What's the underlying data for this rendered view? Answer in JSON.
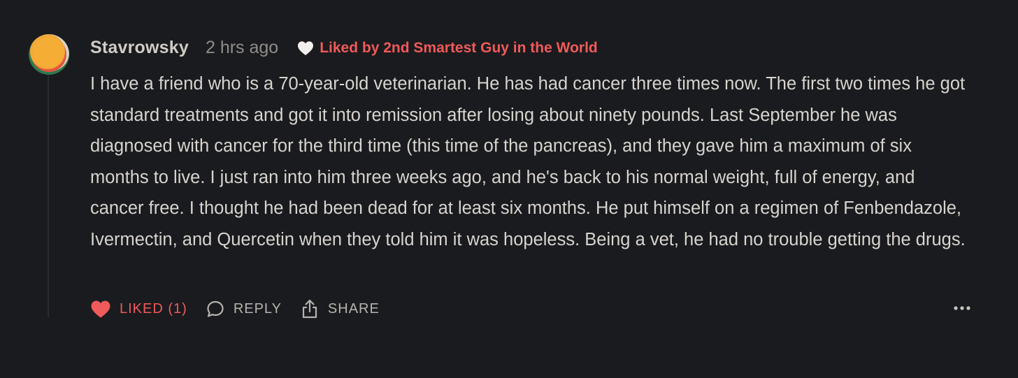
{
  "comment": {
    "author": "Stavrowsky",
    "timestamp": "2 hrs ago",
    "liked_by": "Liked by 2nd Smartest Guy in the World",
    "body": "I have a friend who is a 70-year-old veterinarian. He has had cancer three times now. The first two times he got standard treatments and got it into remission after losing about ninety pounds. Last September he was diagnosed with cancer for the third time (this time of the pancreas), and they gave him a maximum of six months to live. I just ran into him three weeks ago, and he's back to his normal weight, full of energy, and cancer free. I thought he had been dead for at least six months. He put himself on a regimen of Fenbendazole, Ivermectin, and Quercetin when they told him it was hopeless. Being a vet, he had no trouble getting the drugs."
  },
  "actions": {
    "like_label": "LIKED (1)",
    "reply_label": "REPLY",
    "share_label": "SHARE"
  },
  "icons": {
    "like": "heart-filled-icon",
    "reply": "speech-bubble-icon",
    "share": "share-upload-icon",
    "more": "ellipsis-icon",
    "liked_by": "heart-icon"
  },
  "colors": {
    "background": "#1a1b1e",
    "accent": "#f05a5a",
    "text": "#d7d4cf",
    "muted": "#8f8d89"
  }
}
